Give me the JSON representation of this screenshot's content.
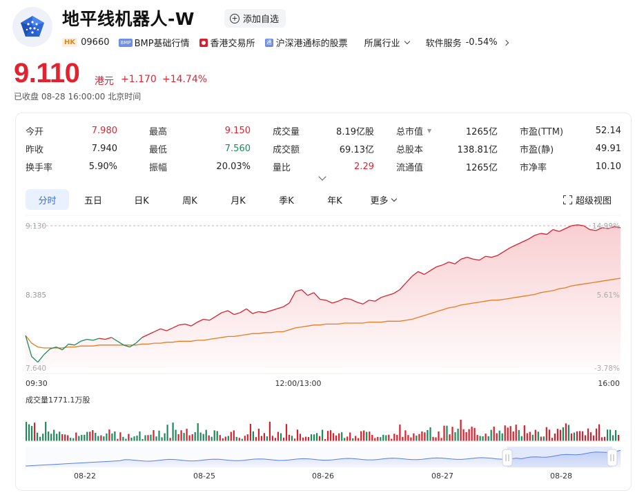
{
  "header": {
    "title": "地平线机器人-W",
    "watch_label": "添加自选",
    "market_badge": "HK",
    "code": "09660",
    "bmp_badge": "BMP",
    "bmp_label": "BMP基础行情",
    "exchange_label": "香港交易所",
    "connect_label": "沪深港通标的股票",
    "industry_label": "所属行业",
    "sector_label": "软件服务",
    "sector_change": "-0.54%"
  },
  "quote": {
    "price": "9.110",
    "currency": "港元",
    "change": "+1.170",
    "change_pct": "+14.74%",
    "status": "已收盘  08-28 16:00:00 北京时间"
  },
  "stats": [
    [
      {
        "label": "今开",
        "value": "7.980",
        "tone": "red"
      },
      {
        "label": "最高",
        "value": "9.150",
        "tone": "red"
      },
      {
        "label": "成交量",
        "value": "8.19亿股",
        "tone": ""
      },
      {
        "label": "总市值",
        "value": "1265亿",
        "tone": ""
      },
      {
        "label": "市盈(TTM)",
        "value": "52.14",
        "tone": ""
      }
    ],
    [
      {
        "label": "昨收",
        "value": "7.940",
        "tone": ""
      },
      {
        "label": "最低",
        "value": "7.560",
        "tone": "green"
      },
      {
        "label": "成交额",
        "value": "69.13亿",
        "tone": ""
      },
      {
        "label": "总股本",
        "value": "138.81亿",
        "tone": ""
      },
      {
        "label": "市盈(静)",
        "value": "49.91",
        "tone": ""
      }
    ],
    [
      {
        "label": "换手率",
        "value": "5.90%",
        "tone": ""
      },
      {
        "label": "振幅",
        "value": "20.03%",
        "tone": ""
      },
      {
        "label": "量比",
        "value": "2.29",
        "tone": "red"
      },
      {
        "label": "流通值",
        "value": "1265亿",
        "tone": ""
      },
      {
        "label": "市净率",
        "value": "10.10",
        "tone": ""
      }
    ]
  ],
  "tabs": [
    "分时",
    "五日",
    "日K",
    "周K",
    "月K",
    "季K",
    "年K",
    "更多"
  ],
  "super_view_label": "超级视图",
  "chart_data": {
    "type": "line",
    "y_labels": {
      "top": "9.130",
      "mid": "8.385",
      "bottom": "7.640"
    },
    "pct_labels": {
      "top": "14.99%",
      "mid": "5.61%",
      "bottom": "-3.78%"
    },
    "time_labels": [
      "09:30",
      "12:00/13:00",
      "16:00"
    ],
    "ylim": [
      7.64,
      9.13
    ],
    "prev_close": 7.94,
    "volume_label": "成交量1771.1万股",
    "navigator_dates": [
      "08-22",
      "08-25",
      "08-26",
      "08-27",
      "08-28"
    ],
    "colors": {
      "price_up": "#d6202b",
      "price_down": "#1a8a5a",
      "avg": "#e87b1e",
      "navigator": "#5b7fe0"
    },
    "series": [
      {
        "name": "price",
        "values": [
          7.98,
          7.76,
          7.7,
          7.78,
          7.84,
          7.86,
          7.83,
          7.89,
          7.88,
          7.92,
          7.94,
          7.93,
          7.95,
          7.94,
          7.96,
          7.92,
          7.88,
          7.86,
          7.9,
          7.96,
          7.99,
          8.02,
          8.05,
          8.03,
          8.06,
          8.09,
          8.1,
          8.08,
          8.12,
          8.15,
          8.14,
          8.18,
          8.22,
          8.24,
          8.2,
          8.22,
          8.26,
          8.21,
          8.23,
          8.22,
          8.24,
          8.26,
          8.28,
          8.32,
          8.44,
          8.46,
          8.4,
          8.43,
          8.36,
          8.35,
          8.32,
          8.34,
          8.37,
          8.36,
          8.33,
          8.31,
          8.35,
          8.34,
          8.38,
          8.4,
          8.42,
          8.46,
          8.53,
          8.6,
          8.65,
          8.62,
          8.66,
          8.7,
          8.72,
          8.75,
          8.73,
          8.78,
          8.8,
          8.78,
          8.77,
          8.81,
          8.8,
          8.82,
          8.86,
          8.9,
          8.93,
          8.96,
          8.99,
          9.03,
          9.05,
          9.04,
          9.09,
          9.07,
          9.1,
          9.13,
          9.14,
          9.13,
          9.09,
          9.08,
          9.11,
          9.1,
          9.12,
          9.11
        ]
      },
      {
        "name": "avg",
        "values": [
          7.98,
          7.9,
          7.86,
          7.85,
          7.85,
          7.85,
          7.85,
          7.86,
          7.86,
          7.87,
          7.87,
          7.87,
          7.88,
          7.88,
          7.88,
          7.88,
          7.88,
          7.88,
          7.88,
          7.89,
          7.89,
          7.9,
          7.9,
          7.91,
          7.91,
          7.92,
          7.92,
          7.92,
          7.93,
          7.93,
          7.94,
          7.95,
          7.96,
          7.97,
          7.97,
          7.98,
          7.99,
          8.0,
          8.0,
          8.01,
          8.01,
          8.02,
          8.02,
          8.04,
          8.06,
          8.07,
          8.08,
          8.09,
          8.09,
          8.1,
          8.1,
          8.1,
          8.11,
          8.11,
          8.11,
          8.11,
          8.12,
          8.12,
          8.12,
          8.13,
          8.13,
          8.13,
          8.14,
          8.15,
          8.17,
          8.19,
          8.21,
          8.23,
          8.25,
          8.27,
          8.28,
          8.3,
          8.31,
          8.32,
          8.33,
          8.34,
          8.35,
          8.35,
          8.36,
          8.37,
          8.38,
          8.39,
          8.4,
          8.41,
          8.43,
          8.44,
          8.45,
          8.47,
          8.48,
          8.5,
          8.51,
          8.52,
          8.53,
          8.54,
          8.55,
          8.56,
          8.57,
          8.58
        ]
      }
    ]
  }
}
